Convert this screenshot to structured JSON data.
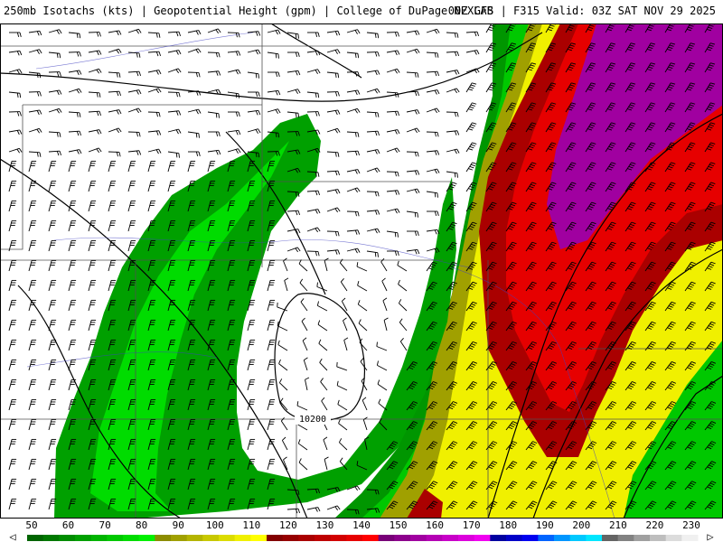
{
  "header": {
    "title_left": "250mb Isotachs (kts) | Geopotential Height (gpm) | College of DuPage NEXLAB",
    "title_right": "00Z GFS | F315 Valid: 03Z SAT NOV 29 2025"
  },
  "contours": {
    "labels": [
      "10200"
    ]
  },
  "legend": {
    "labels": [
      "50",
      "60",
      "70",
      "80",
      "90",
      "100",
      "110",
      "120",
      "130",
      "140",
      "150",
      "160",
      "170",
      "180",
      "190",
      "200",
      "210",
      "220",
      "230"
    ],
    "colors": [
      "#006400",
      "#007800",
      "#008c00",
      "#00a000",
      "#00b400",
      "#00c800",
      "#00dc00",
      "#00f000",
      "#8c8c00",
      "#a0a000",
      "#b4b400",
      "#c8c800",
      "#dcdc00",
      "#f0f000",
      "#ffff00",
      "#820000",
      "#960000",
      "#aa0000",
      "#be0000",
      "#d20000",
      "#e60000",
      "#ff0000",
      "#780078",
      "#8c008c",
      "#a000a0",
      "#b400b4",
      "#c800c8",
      "#dc00dc",
      "#f000f0",
      "#0000a0",
      "#0000c8",
      "#0000f0",
      "#0064ff",
      "#0096ff",
      "#00c8ff",
      "#00e6ff",
      "#646464",
      "#828282",
      "#a0a0a0",
      "#bebebe",
      "#dcdcdc",
      "#f0f0f0"
    ],
    "arrow_left": "◁",
    "arrow_right": "▷"
  }
}
